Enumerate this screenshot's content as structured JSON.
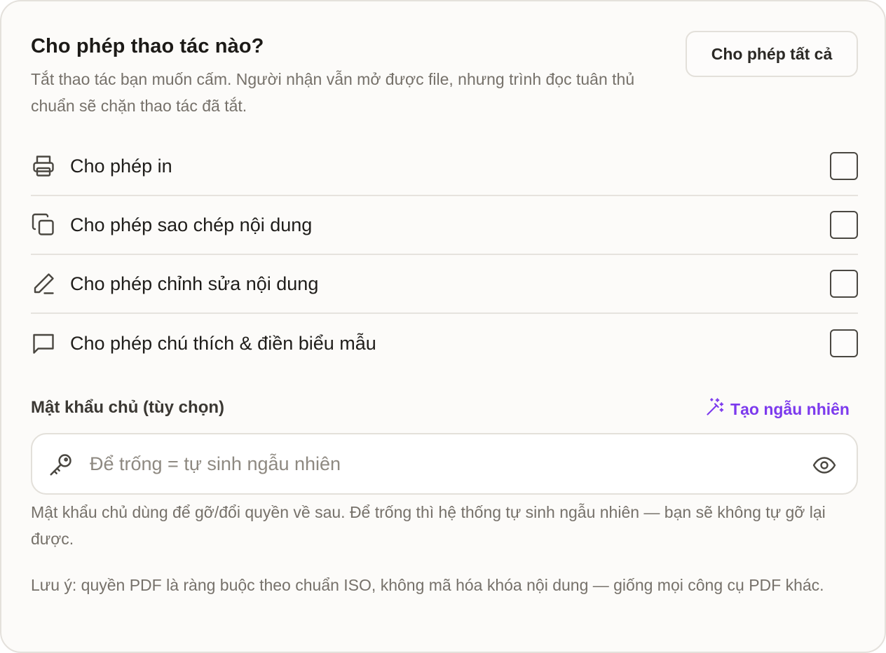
{
  "header": {
    "title": "Cho phép thao tác nào?",
    "subtitle": "Tắt thao tác bạn muốn cấm. Người nhận vẫn mở được file, nhưng trình đọc tuân thủ chuẩn sẽ chặn thao tác đã tắt.",
    "allow_all_label": "Cho phép tất cả"
  },
  "permissions": [
    {
      "label": "Cho phép in",
      "icon": "printer-icon",
      "checked": false
    },
    {
      "label": "Cho phép sao chép nội dung",
      "icon": "copy-icon",
      "checked": false
    },
    {
      "label": "Cho phép chỉnh sửa nội dung",
      "icon": "pencil-icon",
      "checked": false
    },
    {
      "label": "Cho phép chú thích & điền biểu mẫu",
      "icon": "comment-icon",
      "checked": false
    }
  ],
  "password": {
    "label": "Mật khẩu chủ (tùy chọn)",
    "random_label": "Tạo ngẫu nhiên",
    "placeholder": "Để trống = tự sinh ngẫu nhiên",
    "value": "",
    "helper": "Mật khẩu chủ dùng để gỡ/đổi quyền về sau. Để trống thì hệ thống tự sinh ngẫu nhiên — bạn sẽ không tự gỡ lại được."
  },
  "note": "Lưu ý: quyền PDF là ràng buộc theo chuẩn ISO, không mã hóa khóa nội dung — giống mọi công cụ PDF khác.",
  "colors": {
    "accent": "#7c3aed",
    "card_background": "#fcfbf9",
    "muted_text": "#76716a"
  }
}
